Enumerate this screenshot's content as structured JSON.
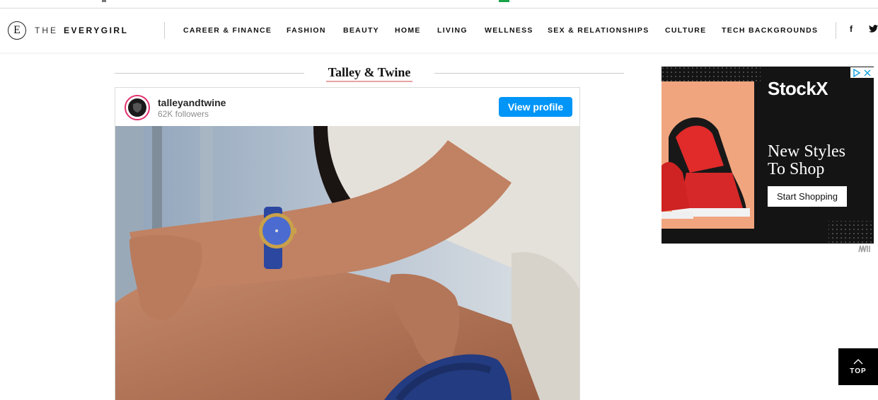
{
  "site": {
    "logo_mark": "E",
    "logo_the": "THE",
    "logo_name": "EVERYGIRL"
  },
  "nav": {
    "items": [
      {
        "label": "CAREER & FINANCE"
      },
      {
        "label": "FASHION"
      },
      {
        "label": "BEAUTY"
      },
      {
        "label": "HOME"
      },
      {
        "label": "LIVING"
      },
      {
        "label": "WELLNESS"
      },
      {
        "label": "SEX & RELATIONSHIPS"
      },
      {
        "label": "CULTURE"
      },
      {
        "label": "TECH BACKGROUNDS"
      }
    ],
    "social": {
      "facebook": "f",
      "twitter": "twitter-icon"
    }
  },
  "section": {
    "title": "Talley & Twine"
  },
  "instagram": {
    "username": "talleyandtwine",
    "followers": "62K followers",
    "view_profile_label": "View profile"
  },
  "ad": {
    "brand": "StockX",
    "headline_line1": "New Styles",
    "headline_line2": "To Shop",
    "cta": "Start Shopping",
    "adchoices_icon": "adchoices-icon",
    "accent": "#141414"
  },
  "top_button": {
    "label": "TOP"
  },
  "colors": {
    "instagram_button": "#0095f6",
    "title_underline": "#e8a2a2"
  }
}
